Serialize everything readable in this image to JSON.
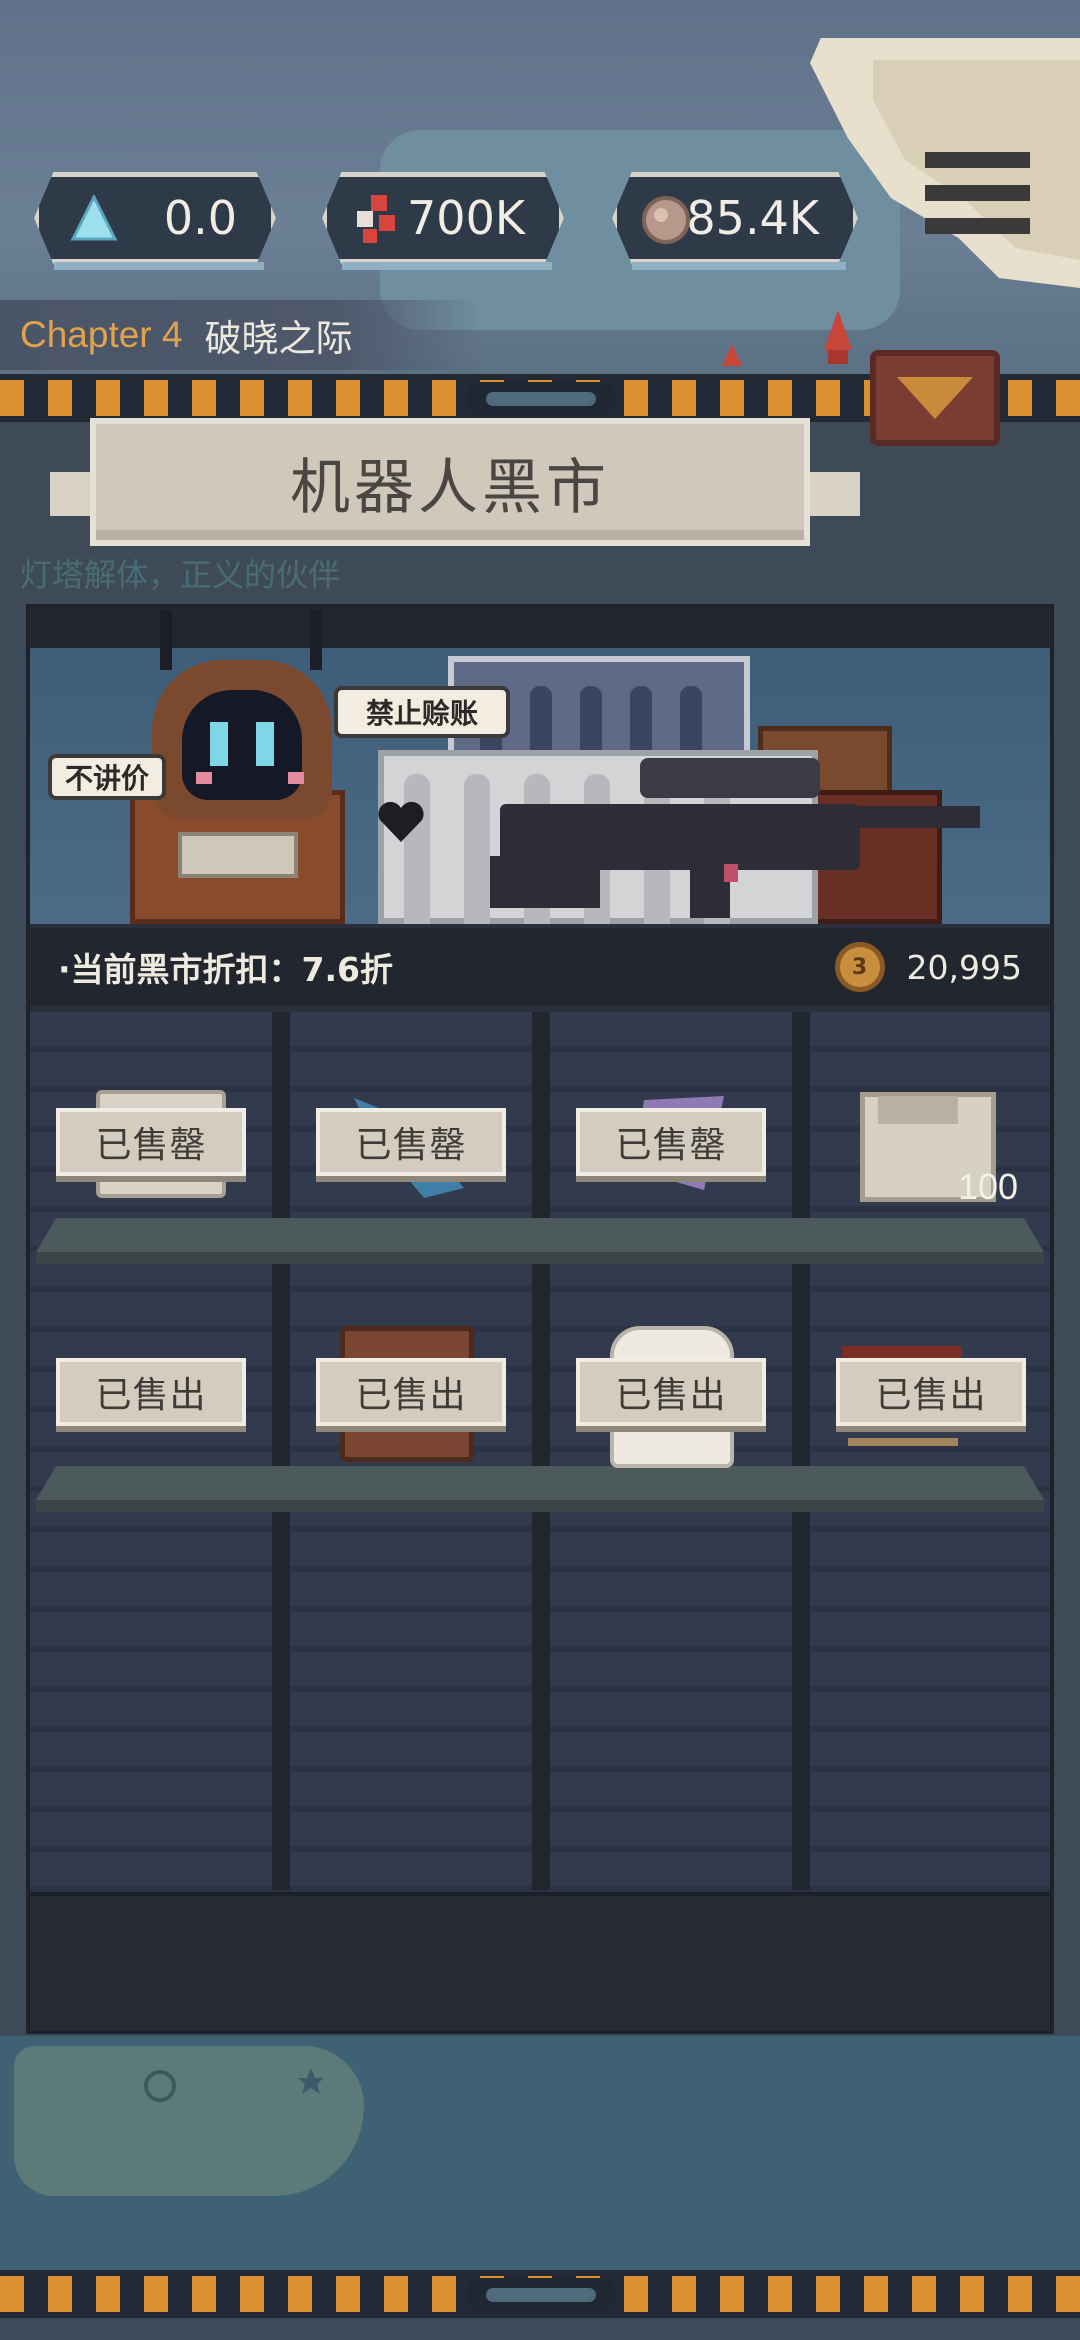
{
  "resources": [
    {
      "icon": "crystal-icon",
      "value": "0.0"
    },
    {
      "icon": "red-parts-icon",
      "value": "700K"
    },
    {
      "icon": "scrap-icon",
      "value": "85.4K"
    }
  ],
  "chapter": {
    "number": "Chapter 4",
    "name": "破晓之际"
  },
  "shop": {
    "title": "机器人黑市",
    "bubble_left": "不讲价",
    "bubble_right": "禁止赊账",
    "discount_label": "·当前黑市折扣：7.6折",
    "coin_glyph": "3",
    "coins": "20,995"
  },
  "faded_text": "灯塔解体，正义的伙伴",
  "shelf_rows": [
    [
      {
        "item": "white-box",
        "tag": "已售罄"
      },
      {
        "item": "blue-fish",
        "tag": "已售罄"
      },
      {
        "item": "purple-shard",
        "tag": "已售罄"
      },
      {
        "item": "white-box",
        "tag": "",
        "quantity": "100"
      }
    ],
    [
      {
        "item": "none",
        "tag": "已售出"
      },
      {
        "item": "brown-book",
        "tag": "已售出"
      },
      {
        "item": "white-shirt",
        "tag": "已售出"
      },
      {
        "item": "red-sign",
        "tag": "已售出"
      }
    ]
  ],
  "colors": {
    "accent_orange": "#d8912e",
    "panel_dark": "#2a303b",
    "tag_bg": "#d3ccbf",
    "chapter_number": "#e0a24a"
  }
}
